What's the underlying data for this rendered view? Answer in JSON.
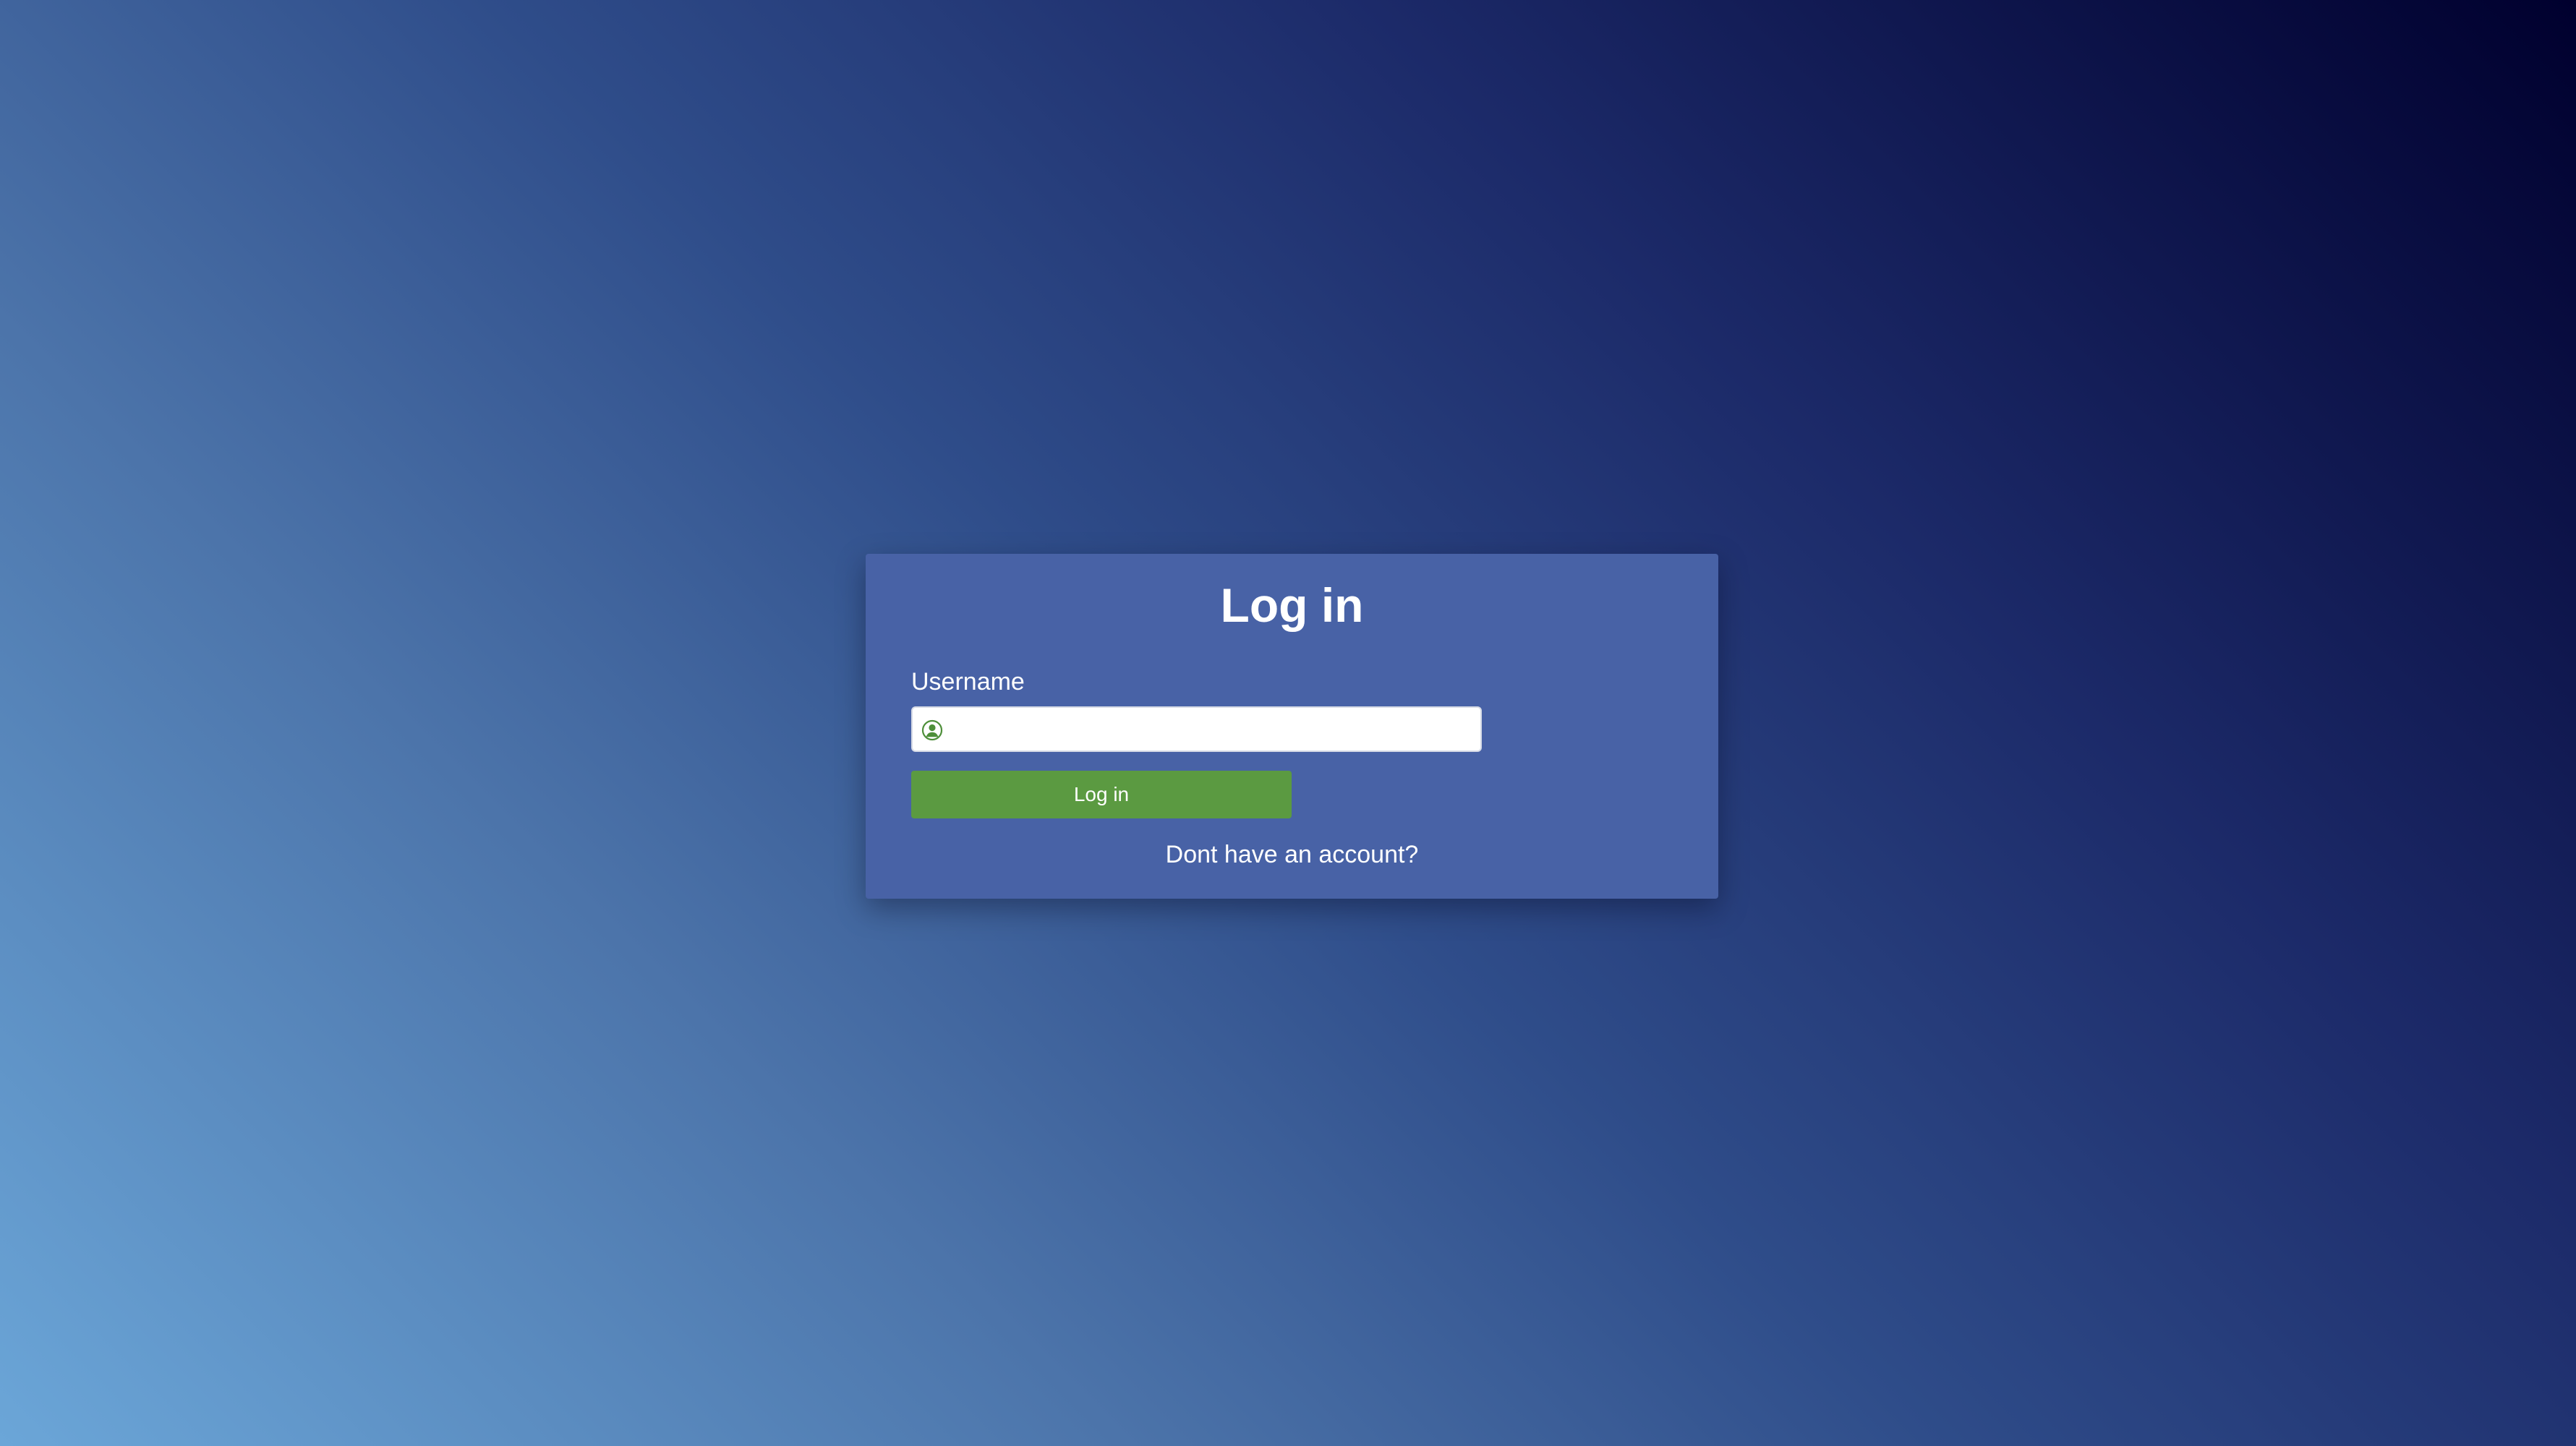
{
  "form": {
    "title": "Log in",
    "username_label": "Username",
    "username_value": "",
    "username_placeholder": "",
    "submit_label": "Log in",
    "signup_link": "Dont have an account?"
  },
  "icons": {
    "username_icon": "user-circle-icon"
  },
  "colors": {
    "card_background": "#4862a6",
    "button_background": "#5b9a41",
    "icon_color": "#4e8f3a"
  }
}
